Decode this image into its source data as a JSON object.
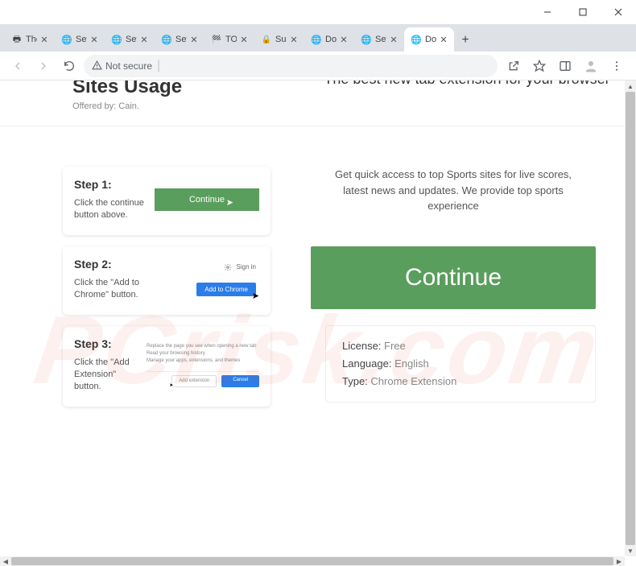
{
  "window": {
    "tabs": [
      {
        "title": "The",
        "icon": "printer"
      },
      {
        "title": "Setu",
        "icon": "globe"
      },
      {
        "title": "Setu",
        "icon": "globe"
      },
      {
        "title": "Setu",
        "icon": "globe"
      },
      {
        "title": "TOP",
        "icon": "flag"
      },
      {
        "title": "Surv",
        "icon": "lock-red"
      },
      {
        "title": "Dov",
        "icon": "globe"
      },
      {
        "title": "Setu",
        "icon": "globe"
      },
      {
        "title": "Dov",
        "icon": "globe",
        "active": true
      }
    ]
  },
  "addressbar": {
    "security_label": "Not secure"
  },
  "brand": {
    "title": "Sites Usage",
    "offered": "Offered by: Cain."
  },
  "tagline": "The best new tab extension for your browser",
  "subtagline": "Get quick access to top Sports sites for live scores, latest news and updates. We provide top sports experience",
  "steps": [
    {
      "title": "Step 1:",
      "desc": "Click the continue button above.",
      "visual_button": "Continue"
    },
    {
      "title": "Step 2:",
      "desc": "Click the \"Add to Chrome\" button.",
      "visual_button": "Add to Chrome",
      "signin": "Sign in"
    },
    {
      "title": "Step 3:",
      "desc": "Click the \"Add Extension\" button.",
      "visual_lines": [
        "Replace the page you see when opening a new tab",
        "Read your browsing history",
        "Manage your apps, extensions, and themes"
      ],
      "visual_btn_add": "Add extension",
      "visual_btn_cancel": "Cancel"
    }
  ],
  "cta": "Continue",
  "info": {
    "license_k": "License:",
    "license_v": " Free",
    "language_k": "Language:",
    "language_v": " English",
    "type_k": "Type:",
    "type_v": " Chrome Extension"
  },
  "watermark": "PCrisk.com"
}
